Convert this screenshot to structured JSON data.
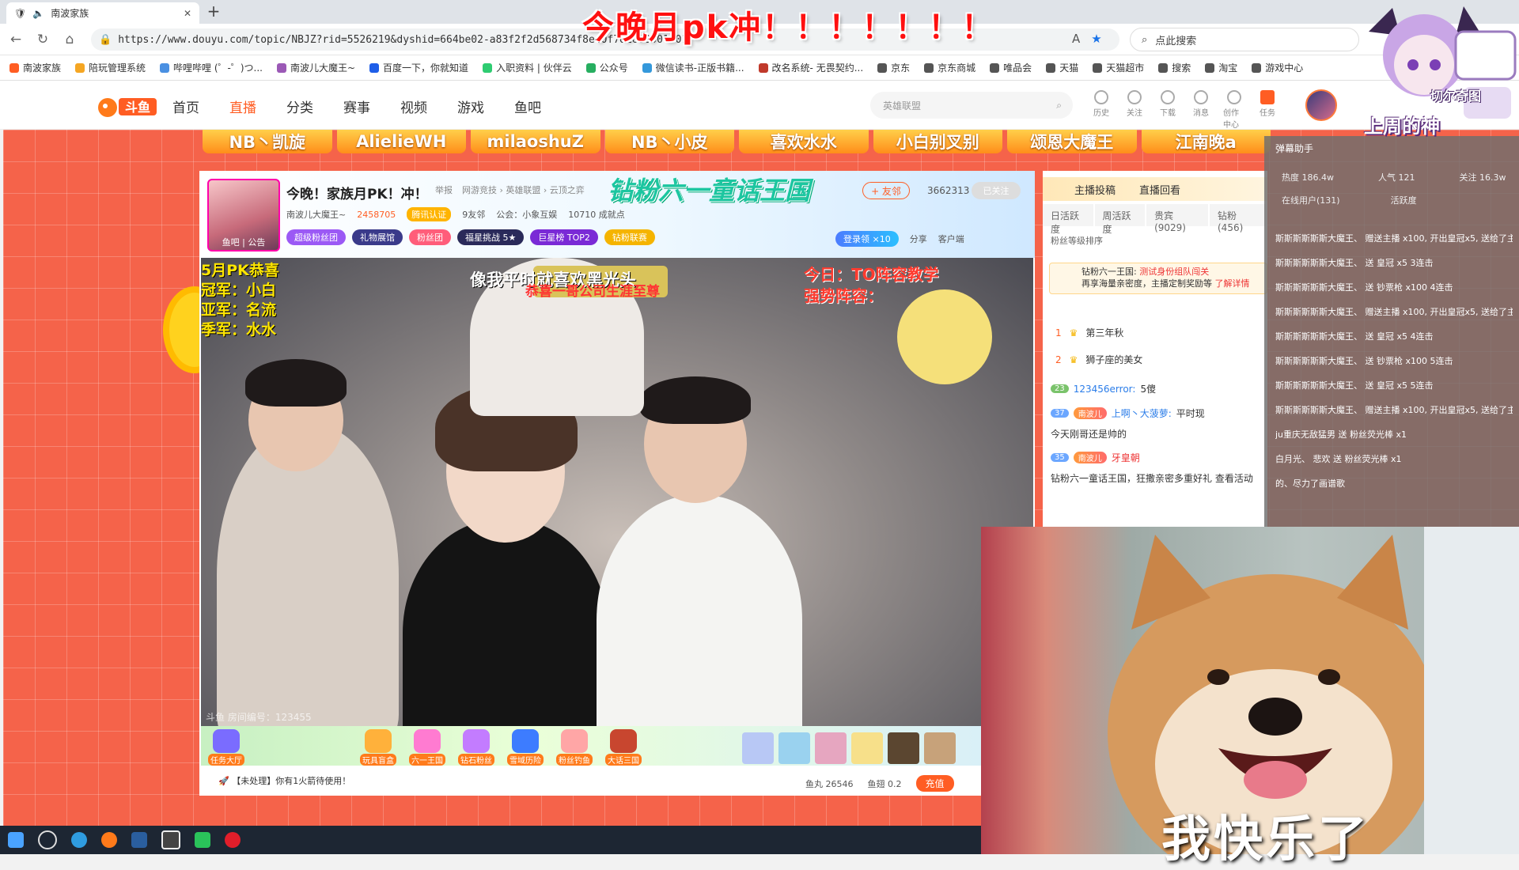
{
  "browser": {
    "tab_title": "南波家族",
    "url": "https://www.douyu.com/topic/NBJZ?rid=5526219&dyshid=664be02-a83f2f2d568734f8ee0f7d1600001601",
    "search_placeholder": "点此搜索",
    "bookmarks": [
      "南波家族",
      "陪玩管理系统",
      "哔哩哔哩 (゜-゜)つ...",
      "南波儿大魔王~",
      "百度一下，你就知道",
      "入职资料 | 伙伴云",
      "公众号",
      "微信读书-正版书籍...",
      "改名系统- 无畏契约...",
      "京东",
      "京东商城",
      "唯品会",
      "天猫",
      "天猫超市",
      "搜索",
      "淘宝",
      "游戏中心"
    ]
  },
  "overlay_title": "今晚月pk冲！！！！！！！",
  "site": {
    "nav": [
      "首页",
      "直播",
      "分类",
      "赛事",
      "视频",
      "游戏",
      "鱼吧"
    ],
    "search_placeholder": "英雄联盟",
    "top_icons": [
      "历史",
      "关注",
      "下载",
      "消息",
      "创作中心",
      "任务"
    ]
  },
  "top_banner": [
    "NB丶凯旋",
    "AlielieWH",
    "milaoshuZ",
    "NB丶小皮",
    "喜欢水水",
    "小白别叉别",
    "颂恩大魔王",
    "江南晚a"
  ],
  "room": {
    "title": "今晚！家族月PK！冲！",
    "report": "举报",
    "breadcrumb": "网游竞技 › 英雄联盟 › 云顶之弈",
    "event_title": "钻粉六一童话王国",
    "follow_label": "+ 友邻",
    "fan_count": "3662313",
    "followed_label": "已关注",
    "anchor_name": "南波儿大魔王~",
    "heat": "2458705",
    "verify_label": "腾讯认证",
    "family": "9友邻",
    "guild": "公会：小象互娱",
    "achievement": "10710 成就点",
    "anchor_tabs": [
      "鱼吧",
      "公告"
    ],
    "badges": [
      "超级粉丝团",
      "礼物展馆",
      "粉丝团",
      "福星挑战 5★",
      "巨星榜 TOP2",
      "钻粉联赛"
    ],
    "login_label": "登录领",
    "login_count": "×10",
    "share": "分享",
    "client": "客户端",
    "room_id_watermark": "斗鱼 房间编号：123455"
  },
  "video_overlays": {
    "left": [
      "5月PK恭喜",
      "冠军：小白",
      "亚军：名流",
      "季军：水水"
    ],
    "center": "像我平时就喜欢黑光头",
    "center_sub": "恭喜一哥公司生涯至尊",
    "right": [
      "今日：TO阵容教学",
      "强势阵容："
    ]
  },
  "gifts": [
    "任务大厅",
    "玩具盲盒",
    "六一王国",
    "钻石粉丝",
    "雪域历险",
    "粉丝钓鱼",
    "大话三国"
  ],
  "notice": "【未处理】你有1火箭待使用！",
  "coins": {
    "fish_ball": "鱼丸 26546",
    "fish_wing": "鱼翅 0.2",
    "charge": "充值"
  },
  "chat": {
    "header": [
      "主播投稿",
      "直播回看"
    ],
    "tabs": [
      "日活跃度",
      "周活跃度",
      "贵宾(9029)",
      "钻粉(456)"
    ],
    "fan_sort": "粉丝等级排序",
    "banner_title": "钻粉六一王国:",
    "banner_red": "测试身份组队闯关",
    "banner_line2": "再享海量亲密度，主播定制奖励等",
    "banner_link": "了解详情",
    "ranks": [
      {
        "pos": "1",
        "name": "第三年秋"
      },
      {
        "pos": "2",
        "name": "狮子座的美女"
      }
    ],
    "messages": [
      {
        "lvl": "23",
        "nick": "123456error:",
        "text": "5傻"
      },
      {
        "lvl": "37",
        "nick": "上啊丶大菠萝:",
        "text": "平时现"
      },
      {
        "lvl": "",
        "nick": "",
        "text": "今天刚哥还是帅的"
      },
      {
        "lvl": "35",
        "nick": "牙皇朝",
        "text": ""
      },
      {
        "lvl": "",
        "nick": "",
        "text": "钻粉六一童话王国，狂撒亲密多重好礼 查看活动"
      }
    ]
  },
  "danmaku": {
    "title": "弹幕助手",
    "heat": "热度 186.4w",
    "popularity": "人气 121",
    "follow": "关注 16.3w",
    "online": "在线用户(131)",
    "active": "活跃度",
    "lines": [
      "斯斯斯斯斯斯大魔王、 赠送主播 x100, 开出皇冠x5, 送给了主播",
      "斯斯斯斯斯斯大魔王、 送 皇冠 x5 3连击",
      "斯斯斯斯斯斯大魔王、 送 钞票枪 x100 4连击",
      "斯斯斯斯斯斯大魔王、 赠送主播 x100, 开出皇冠x5, 送给了主播",
      "斯斯斯斯斯斯大魔王、 送 皇冠 x5 4连击",
      "斯斯斯斯斯斯大魔王、 送 钞票枪 x100 5连击",
      "斯斯斯斯斯斯大魔王、 送 皇冠 x5 5连击",
      "斯斯斯斯斯斯大魔王、 赠送主播 x100, 开出皇冠x5, 送给了主播",
      "ju重庆无敌猛男 送 粉丝荧光棒 x1",
      "白月光、 悲欢 送 粉丝荧光棒 x1",
      "的、尽力了画谱歌"
    ]
  },
  "chibi": {
    "name": "切尔奇图",
    "caption": "上周的神"
  },
  "dog_caption": "我快乐了",
  "colors": {
    "accent": "#ff5d23",
    "page_bg": "#f5634a",
    "overlay_red": "#ff1010"
  }
}
